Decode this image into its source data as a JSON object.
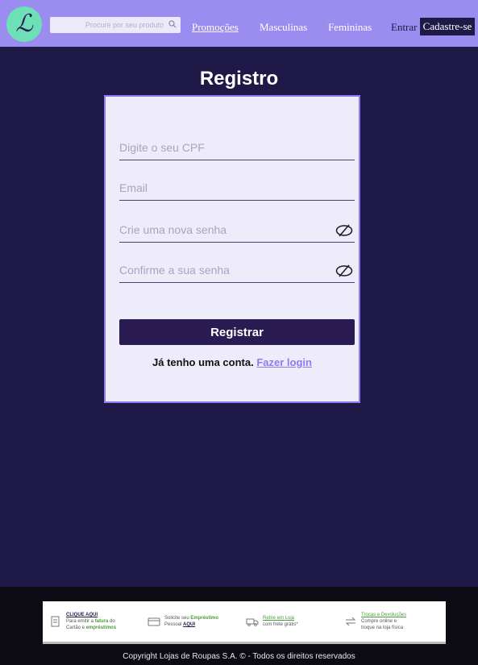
{
  "header": {
    "logo_letter": "ℒ",
    "search": {
      "placeholder": "Procure por seu produto",
      "value": "",
      "icon": "search-icon"
    },
    "nav": {
      "promocoes": "Promoções",
      "masculinas": "Masculinas",
      "femininas": "Femininas",
      "entrar": "Entrar",
      "cadastre": "Cadastre-se"
    },
    "colors": {
      "bar": "#9b8cf0",
      "logo": "#6ee0b8",
      "accent": "#1e1946"
    }
  },
  "page": {
    "title": "Registro",
    "background": "#1e1946"
  },
  "form": {
    "cpf_placeholder": "Digite o seu CPF",
    "email_placeholder": "Email",
    "password_placeholder": "Crie uma nova senha",
    "confirm_placeholder": "Confirme a sua senha",
    "password_toggle_icon": "eye-off-icon",
    "submit_label": "Registrar",
    "login_prompt": "Já tenho uma conta.",
    "login_link": "Fazer login"
  },
  "footer": {
    "items": [
      {
        "icon": "document-icon",
        "title": "CLIQUE AQUI",
        "line1": "Para emitir a",
        "hl1": "fatura",
        "line1b": "do",
        "line2": "Cartão e",
        "hl2": "empréstimos"
      },
      {
        "icon": "card-icon",
        "title": "Solicite seu",
        "hl1": "Empréstimo",
        "line2": "Pessoal",
        "link2": "AQUI"
      },
      {
        "icon": "truck-icon",
        "title": "Retire em Loja",
        "line2": "com frete grátis*"
      },
      {
        "icon": "exchange-icon",
        "title": "Trocas e Devoluções",
        "line1": "Compre online e",
        "line2": "troque na loja física"
      }
    ],
    "copyright": "Copyright Lojas de Roupas S.A. © - Todos os direitos reservados"
  }
}
